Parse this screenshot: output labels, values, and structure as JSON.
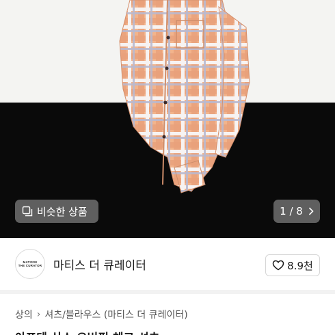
{
  "photo": {
    "similar_label": "비슷한 상품",
    "pager": "1 / 8"
  },
  "seller": {
    "avatar_line1": "MATISSE",
    "avatar_line2": "THE CURATOR",
    "name": "마티스 더 큐레이터",
    "likes": "8.9천"
  },
  "breadcrumb": {
    "items": [
      "상의",
      "셔츠/블라우스 (마티스 더 큐레이터)"
    ]
  },
  "product": {
    "title": "아포테 산스 오버핏 체크 셔츠"
  }
}
